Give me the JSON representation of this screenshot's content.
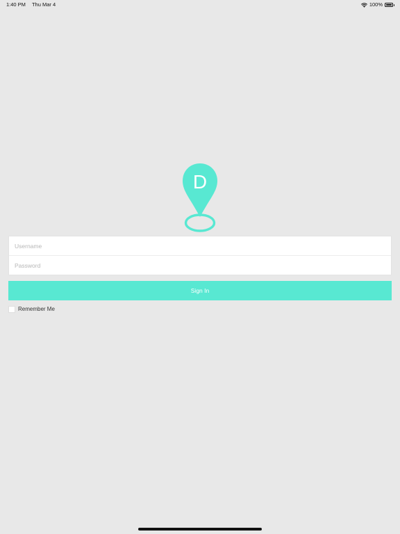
{
  "status_bar": {
    "time": "1:40 PM",
    "date": "Thu Mar 4",
    "battery_label": "100%",
    "wifi_icon": "wifi-icon",
    "battery_icon": "battery-full-icon"
  },
  "logo": {
    "letter": "D",
    "icon": "location-pin-icon",
    "color": "#58e8d2"
  },
  "form": {
    "username_placeholder": "Username",
    "username_value": "",
    "password_placeholder": "Password",
    "password_value": "",
    "sign_in_label": "Sign In",
    "remember_me_label": "Remember Me",
    "remember_me_checked": false
  },
  "colors": {
    "accent": "#58e8d2",
    "background": "#e8e8e8"
  }
}
